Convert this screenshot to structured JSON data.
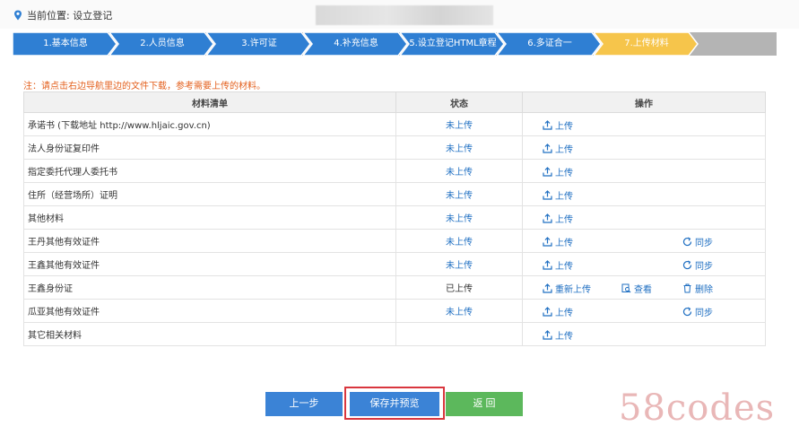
{
  "location": {
    "label": "当前位置: 设立登记"
  },
  "steps": [
    {
      "label": "1.基本信息",
      "state": "done"
    },
    {
      "label": "2.人员信息",
      "state": "done"
    },
    {
      "label": "3.许可证",
      "state": "done"
    },
    {
      "label": "4.补充信息",
      "state": "done"
    },
    {
      "label": "5.设立登记HTML章程",
      "state": "done"
    },
    {
      "label": "6.多证合一",
      "state": "done"
    },
    {
      "label": "7.上传材料",
      "state": "current"
    }
  ],
  "note": "注：请点击右边导航里边的文件下载，参考需要上传的材料。",
  "table": {
    "headers": {
      "name": "材料清单",
      "status": "状态",
      "ops": "操作"
    },
    "rows": [
      {
        "name": "承诺书 (下载地址 http://www.hljaic.gov.cn)",
        "status": "未上传",
        "upload": "上传"
      },
      {
        "name": "法人身份证复印件",
        "status": "未上传",
        "upload": "上传"
      },
      {
        "name": "指定委托代理人委托书",
        "status": "未上传",
        "upload": "上传"
      },
      {
        "name": "住所（经营场所）证明",
        "status": "未上传",
        "upload": "上传"
      },
      {
        "name": "其他材料",
        "status": "未上传",
        "upload": "上传"
      },
      {
        "name": "王丹其他有效证件",
        "status": "未上传",
        "upload": "上传",
        "sync": "同步"
      },
      {
        "name": "王鑫其他有效证件",
        "status": "未上传",
        "upload": "上传",
        "sync": "同步"
      },
      {
        "name": "王鑫身份证",
        "status": "已上传",
        "upload": "重新上传",
        "view": "查看",
        "delete": "删除"
      },
      {
        "name": "瓜亚其他有效证件",
        "status": "未上传",
        "upload": "上传",
        "sync": "同步"
      },
      {
        "name": "其它相关材料",
        "status": "",
        "upload": "上传"
      }
    ]
  },
  "buttons": {
    "prev": "上一步",
    "save": "保存并预览",
    "back": "返 回"
  },
  "watermark": "58codes",
  "colors": {
    "step_done": "#2f7fd3",
    "step_current": "#f6c54b",
    "step_rest": "#b4b4b4",
    "link": "#1f6fc2",
    "note": "#e35f1c"
  }
}
